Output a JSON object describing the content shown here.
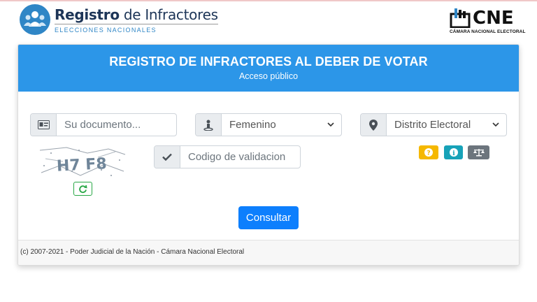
{
  "header": {
    "logo_title_bold": "Registro",
    "logo_title_rest": " de Infractores",
    "logo_subtitle": "ELECCIONES NACIONALES",
    "cne_text": "CNE",
    "cne_subtitle": "CÁMARA NACIONAL ELECTORAL"
  },
  "card": {
    "title": "REGISTRO DE INFRACTORES AL DEBER DE VOTAR",
    "subtitle": "Acceso público"
  },
  "form": {
    "document_placeholder": "Su documento...",
    "gender_value": "Femenino",
    "district_value": "Distrito Electoral",
    "validation_placeholder": "Codigo de validacion",
    "captcha_text": "H7 F8",
    "submit_label": "Consultar"
  },
  "info_buttons": [
    {
      "icon": "question-icon",
      "color": "#f5b800"
    },
    {
      "icon": "info-icon",
      "color": "#17a2b8"
    },
    {
      "icon": "scales-icon",
      "color": "#6c757d"
    }
  ],
  "footer": {
    "text": "(c) 2007-2021 - Poder Judicial de la Nación - Cámara Nacional Electoral"
  },
  "colors": {
    "header_blue": "#2c96e8",
    "primary_button": "#0d7ffd",
    "refresh_green": "#28a745"
  }
}
